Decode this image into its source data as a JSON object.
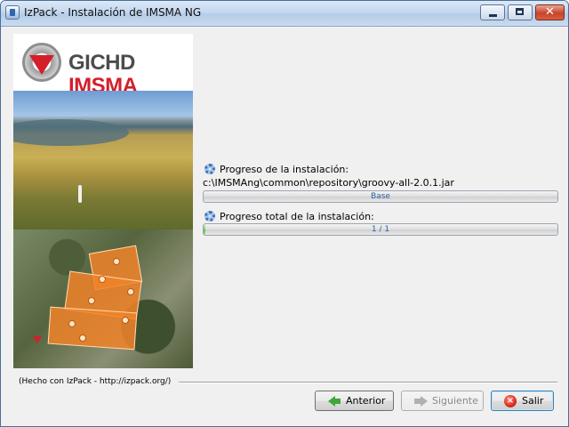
{
  "window": {
    "title": "IzPack - Instalación de IMSMA NG",
    "minimize": "minimize",
    "maximize": "maximize",
    "close": "✕"
  },
  "logo": {
    "part1": "GICHD",
    "part2": "IMSMA"
  },
  "progress": {
    "pack_label": "Progreso de la instalación:",
    "current_file": "c:\\IMSMAng\\common\\repository\\groovy-all-2.0.1.jar",
    "pack_bar_text": "Base",
    "pack_bar_fraction": 0,
    "overall_label": "Progreso total de la instalación:",
    "overall_bar_text": "1 / 1",
    "overall_bar_fraction": 0.004
  },
  "footer": {
    "made_with": "(Hecho con IzPack - http://izpack.org/)"
  },
  "buttons": {
    "previous": "Anterior",
    "next": "Siguiente",
    "exit": "Salir"
  },
  "icons": {
    "app": "izpack-app-icon",
    "progress": "gear-icon",
    "previous": "arrow-left-icon",
    "next": "arrow-right-icon",
    "exit": "exit-icon"
  },
  "colors": {
    "progress_text": "#2b5fa5",
    "accent_red": "#d41f2b",
    "previous_arrow": "#3fa63a"
  }
}
